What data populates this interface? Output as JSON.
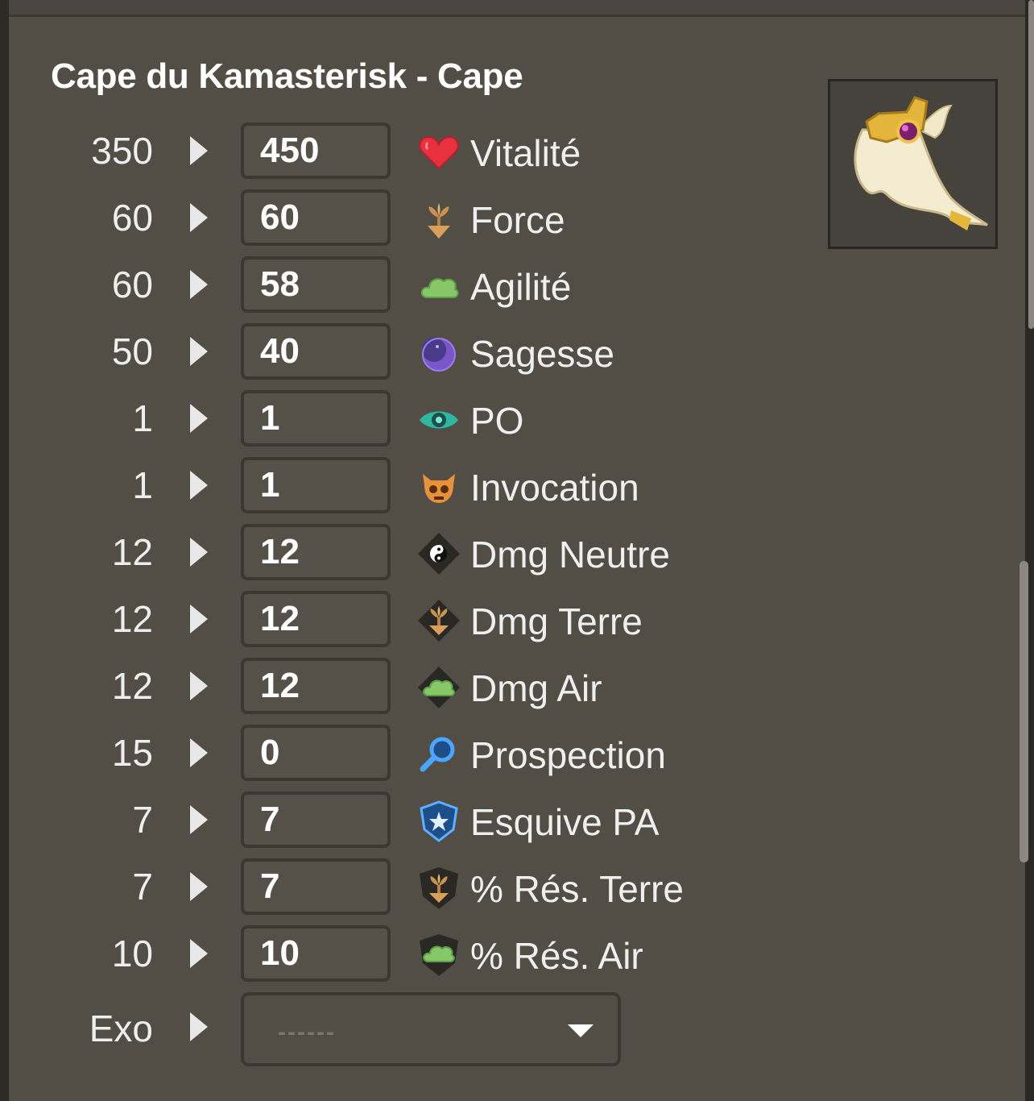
{
  "title": "Cape du Kamasterisk - Cape",
  "item_image": "cape-image",
  "stats": [
    {
      "base": "350",
      "value": "450",
      "label": "Vitalité",
      "icon": "heart-icon"
    },
    {
      "base": "60",
      "value": "60",
      "label": "Force",
      "icon": "earth-sprout-icon"
    },
    {
      "base": "60",
      "value": "58",
      "label": "Agilité",
      "icon": "air-cloud-icon"
    },
    {
      "base": "50",
      "value": "40",
      "label": "Sagesse",
      "icon": "moon-icon"
    },
    {
      "base": "1",
      "value": "1",
      "label": "PO",
      "icon": "eye-icon"
    },
    {
      "base": "1",
      "value": "1",
      "label": "Invocation",
      "icon": "skull-icon"
    },
    {
      "base": "12",
      "value": "12",
      "label": "Dmg Neutre",
      "icon": "neutral-damage-icon"
    },
    {
      "base": "12",
      "value": "12",
      "label": "Dmg Terre",
      "icon": "earth-damage-icon"
    },
    {
      "base": "12",
      "value": "12",
      "label": "Dmg Air",
      "icon": "air-damage-icon"
    },
    {
      "base": "15",
      "value": "0",
      "label": "Prospection",
      "icon": "magnifier-icon"
    },
    {
      "base": "7",
      "value": "7",
      "label": "Esquive PA",
      "icon": "shield-star-icon"
    },
    {
      "base": "7",
      "value": "7",
      "label": "% Rés. Terre",
      "icon": "earth-resistance-icon"
    },
    {
      "base": "10",
      "value": "10",
      "label": "% Rés. Air",
      "icon": "air-resistance-icon"
    }
  ],
  "exo": {
    "label": "Exo",
    "value": "------"
  }
}
